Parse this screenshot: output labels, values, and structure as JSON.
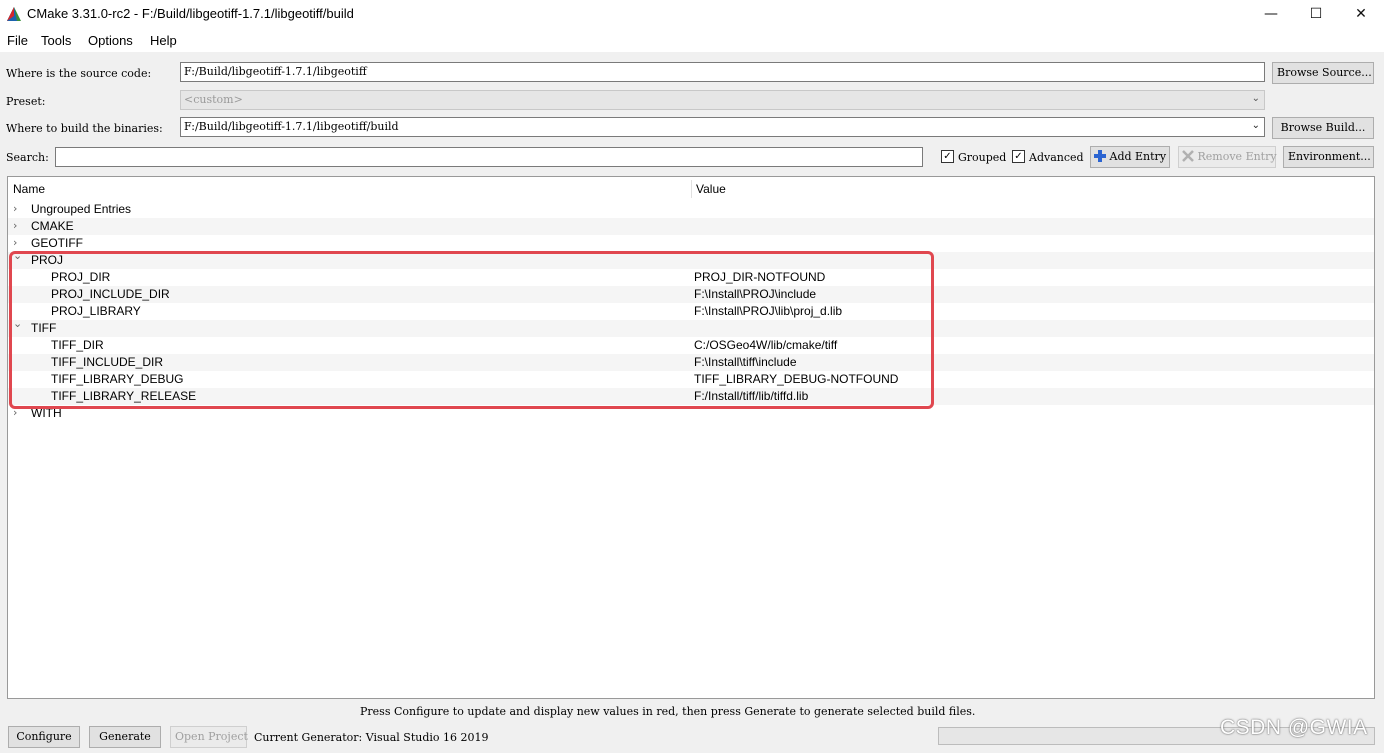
{
  "window": {
    "title": "CMake 3.31.0-rc2 - F:/Build/libgeotiff-1.7.1/libgeotiff/build",
    "minimize": "—",
    "maximize": "☐",
    "close": "✕"
  },
  "menu": [
    "File",
    "Tools",
    "Options",
    "Help"
  ],
  "source": {
    "label": "Where is the source code:",
    "value": "F:/Build/libgeotiff-1.7.1/libgeotiff",
    "button": "Browse Source..."
  },
  "preset": {
    "label": "Preset:",
    "value": "<custom>"
  },
  "build": {
    "label": "Where to build the binaries:",
    "value": "F:/Build/libgeotiff-1.7.1/libgeotiff/build",
    "button": "Browse Build..."
  },
  "search": {
    "label": "Search:",
    "value": "",
    "grouped_label": "Grouped",
    "grouped_checked": true,
    "advanced_label": "Advanced",
    "advanced_checked": true,
    "add_entry": "Add Entry",
    "remove_entry": "Remove Entry",
    "environment": "Environment..."
  },
  "table": {
    "col_name": "Name",
    "col_value": "Value",
    "rows": [
      {
        "type": "group",
        "expanded": false,
        "name": "Ungrouped Entries",
        "value": ""
      },
      {
        "type": "group",
        "expanded": false,
        "name": "CMAKE",
        "value": ""
      },
      {
        "type": "group",
        "expanded": false,
        "name": "GEOTIFF",
        "value": ""
      },
      {
        "type": "group",
        "expanded": true,
        "name": "PROJ",
        "value": ""
      },
      {
        "type": "entry",
        "name": "PROJ_DIR",
        "value": "PROJ_DIR-NOTFOUND"
      },
      {
        "type": "entry",
        "name": "PROJ_INCLUDE_DIR",
        "value": "F:\\Install\\PROJ\\include"
      },
      {
        "type": "entry",
        "name": "PROJ_LIBRARY",
        "value": "F:\\Install\\PROJ\\lib\\proj_d.lib"
      },
      {
        "type": "group",
        "expanded": true,
        "name": "TIFF",
        "value": ""
      },
      {
        "type": "entry",
        "name": "TIFF_DIR",
        "value": "C:/OSGeo4W/lib/cmake/tiff"
      },
      {
        "type": "entry",
        "name": "TIFF_INCLUDE_DIR",
        "value": "F:\\Install\\tiff\\include"
      },
      {
        "type": "entry",
        "name": "TIFF_LIBRARY_DEBUG",
        "value": "TIFF_LIBRARY_DEBUG-NOTFOUND"
      },
      {
        "type": "entry",
        "name": "TIFF_LIBRARY_RELEASE",
        "value": "F:/Install/tiff/lib/tiffd.lib"
      },
      {
        "type": "group",
        "expanded": false,
        "name": "WITH",
        "value": ""
      }
    ]
  },
  "status": {
    "message": "Press Configure to update and display new values in red,  then press Generate to generate selected build files.",
    "configure": "Configure",
    "generate": "Generate",
    "open_project": "Open Project",
    "generator": "Current Generator: Visual Studio 16 2019"
  },
  "watermark": "CSDN @GWIA",
  "colors": {
    "highlight_box": "#e0474f",
    "icon_plus": "#2b64d1"
  }
}
